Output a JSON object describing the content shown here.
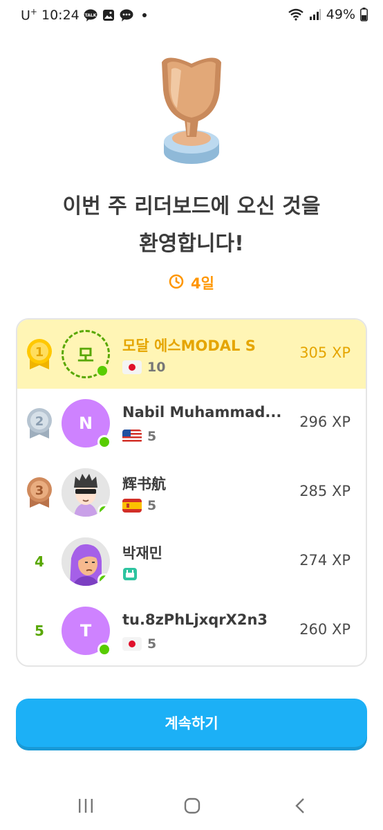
{
  "status_bar": {
    "carrier": "U",
    "carrier_sup": "+",
    "time": "10:24",
    "battery": "49%"
  },
  "title_line1": "이번 주 리더보드에 오신 것을",
  "title_line2": "환영합니다!",
  "timer": {
    "label": "4일"
  },
  "leaderboard": [
    {
      "rank": "1",
      "avatar_text": "모",
      "name": "모달 에스MODAL S",
      "flag": "japan-flag",
      "streak": "10",
      "xp": "305 XP",
      "highlight": true
    },
    {
      "rank": "2",
      "avatar_text": "N",
      "name": "Nabil Muhammad...",
      "flag": "usa-flag",
      "streak": "5",
      "xp": "296 XP"
    },
    {
      "rank": "3",
      "avatar_text": "",
      "name": "辉书航",
      "flag": "spain-flag",
      "streak": "5",
      "xp": "285 XP"
    },
    {
      "rank": "4",
      "avatar_text": "",
      "name": "박재민",
      "flag": "calendar-badge",
      "streak": "",
      "xp": "274 XP"
    },
    {
      "rank": "5",
      "avatar_text": "T",
      "name": "tu.8zPhLjxqrX2n3",
      "flag": "japan-flag",
      "streak": "5",
      "xp": "260 XP"
    }
  ],
  "continue_label": "계속하기",
  "colors": {
    "accent_blue": "#1cb0f6",
    "highlight_bg": "#fff5b5",
    "gold": "#e5a500",
    "green": "#58cc02",
    "orange": "#ff9600"
  }
}
